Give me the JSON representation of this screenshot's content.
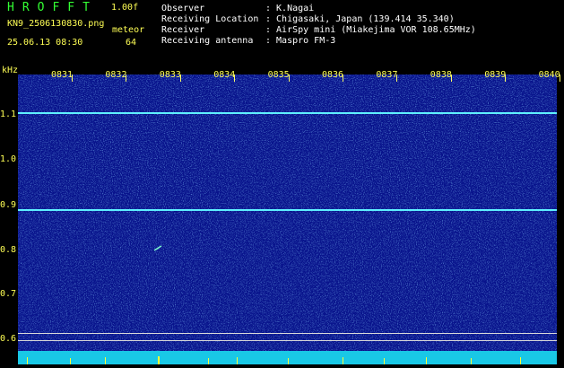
{
  "header": {
    "brand": "HROFFT",
    "version": "1.00f",
    "filename": "KN9_2506130830.png",
    "mode": "meteor",
    "datetime": "25.06.13 08:30",
    "count": "64"
  },
  "info": {
    "observer_label": "Observer",
    "observer_value": ": K.Nagai",
    "location_label": "Receiving Location",
    "location_value": ": Chigasaki, Japan (139.414 35.340)",
    "receiver_label": "Receiver",
    "receiver_value": ": AirSpy mini (Miakejima VOR 108.65MHz)",
    "antenna_label": "Receiving antenna",
    "antenna_value": ": Maspro FM-3"
  },
  "axis": {
    "unit": "kHz",
    "y_ticks": [
      "1.1",
      "1.0",
      "0.9",
      "0.8",
      "0.7",
      "0.6"
    ],
    "x_ticks": [
      "0831",
      "0832",
      "0833",
      "0834",
      "0835",
      "0836",
      "0837",
      "0838",
      "0839",
      "0840"
    ]
  },
  "colors": {
    "background": "#08138c",
    "carrier": "#5ff0ff",
    "labels": "#ffff55"
  }
}
